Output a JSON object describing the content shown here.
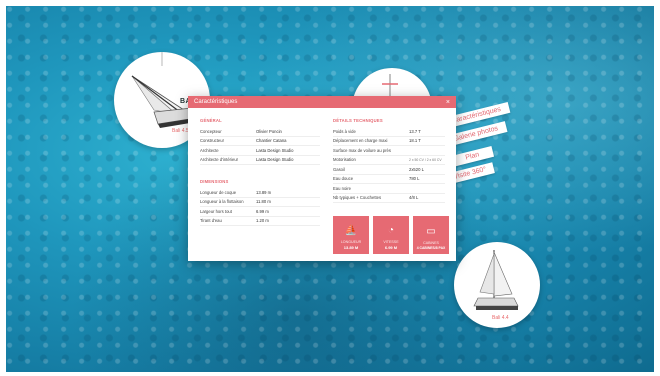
{
  "nav": {
    "items": [
      {
        "label": "Caractéristiques"
      },
      {
        "label": "Galerie photos"
      },
      {
        "label": "Plan"
      },
      {
        "label": "Visite 360°"
      }
    ]
  },
  "bubbles": {
    "left_brand": "BALI",
    "left_label": "Bali 4.5",
    "right_label": "Bali 4.4"
  },
  "modal": {
    "title": "Caractéristiques",
    "close": "×",
    "general": {
      "title": "GÉNÉRAL",
      "rows": [
        {
          "k": "Concepteur",
          "v": "Olivier Poncin"
        },
        {
          "k": "Constructeur",
          "v": "Chantier Catana"
        },
        {
          "k": "Architecte",
          "v": "Lasta Design Studio"
        },
        {
          "k": "Architecte d'intérieur",
          "v": "Lasta Design Studio"
        }
      ]
    },
    "dimensions": {
      "title": "DIMENSIONS",
      "rows": [
        {
          "k": "Longueur de coque",
          "v": "13.89 m"
        },
        {
          "k": "Longueur à la flottaison",
          "v": "11.80 m"
        },
        {
          "k": "Largeur hors tout",
          "v": "6.99 m"
        },
        {
          "k": "Tirant d'eau",
          "v": "1.20 m"
        }
      ]
    },
    "technical": {
      "title": "DÉTAILS TECHNIQUES",
      "rows": [
        {
          "k": "Poids à vide",
          "v": "13.7 T"
        },
        {
          "k": "Déplacement en charge maxi",
          "v": "18.1 T"
        },
        {
          "k": "Surface max de voilure au près",
          "v": ""
        },
        {
          "k": "Motorisation",
          "v": "2 x 50 CV / 2 x 60 CV"
        },
        {
          "k": "Gasoil",
          "v": "2x520 L"
        },
        {
          "k": "Eau douce",
          "v": "780 L"
        },
        {
          "k": "Eau noire",
          "v": ""
        },
        {
          "k": "Nb typiques + Couchettes",
          "v": "4/8 L"
        }
      ]
    },
    "tiles": [
      {
        "label": "LONGUEUR",
        "value": "13.89 M",
        "icon": "sailboat-icon"
      },
      {
        "label": "VITESSE",
        "value": "6.99 M",
        "icon": "gauge-icon"
      },
      {
        "label": "CABINES",
        "value": "4 CABINES/8 PAX",
        "icon": "bed-icon"
      }
    ]
  },
  "colors": {
    "accent": "#e66a73",
    "sea": "#1f97bd"
  }
}
